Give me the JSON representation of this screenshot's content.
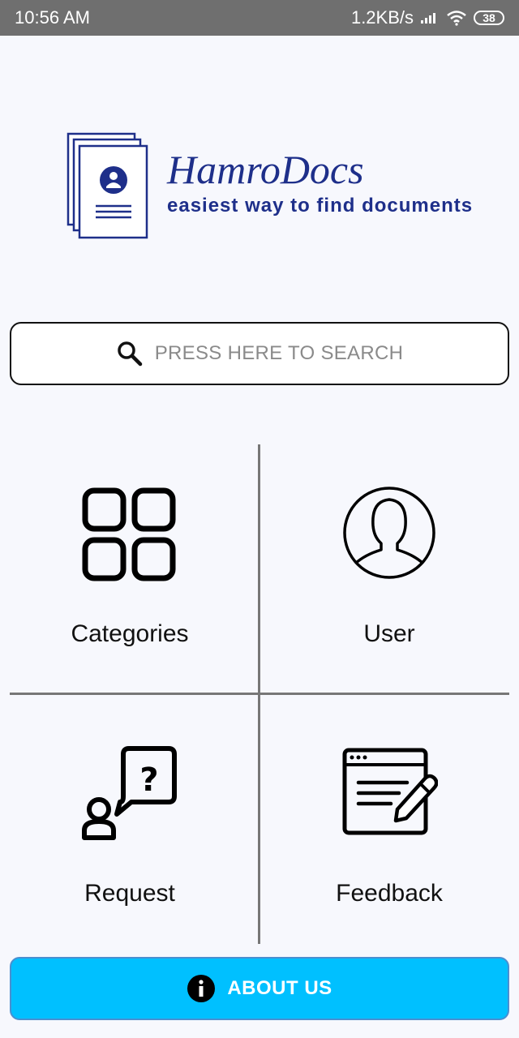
{
  "status_bar": {
    "time": "10:56  AM",
    "network_speed": "1.2KB/s",
    "battery": "38",
    "icons": [
      "signal-icon",
      "wifi-icon",
      "battery-icon"
    ]
  },
  "logo": {
    "title": "HamroDocs",
    "tagline": "easiest way to find documents",
    "icon": "document-stack-icon",
    "color": "#1e2f8a"
  },
  "search": {
    "placeholder": "PRESS HERE TO SEARCH",
    "icon": "search-icon"
  },
  "menu": [
    {
      "label": "Categories",
      "icon": "grid-icon"
    },
    {
      "label": "User",
      "icon": "user-icon"
    },
    {
      "label": "Request",
      "icon": "question-bubble-icon"
    },
    {
      "label": "Feedback",
      "icon": "feedback-edit-icon"
    }
  ],
  "about_button": {
    "label": "ABOUT US",
    "icon": "info-icon",
    "color": "#00c0ff"
  }
}
